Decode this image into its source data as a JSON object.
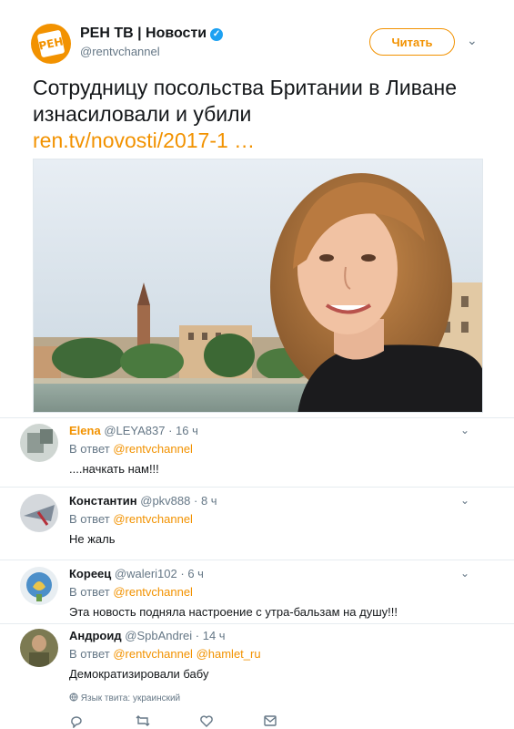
{
  "tweet": {
    "author_name": "РЕН ТВ | Новости",
    "author_handle": "@rentvchannel",
    "follow_label": "Читать",
    "text": "Сотрудницу посольства Британии в Ливане изнасиловали и убили",
    "link": "ren.tv/novosti/2017-1 …",
    "avatar_logo_text": "РЕН",
    "verified_symbol": "✓",
    "caret_symbol": "⌄"
  },
  "replies": [
    {
      "name": "Elena",
      "handle": "@LEYA837",
      "time": "· 16 ч",
      "reply_to_prefix": "В ответ ",
      "reply_to": "@rentvchannel",
      "reply_to_extra": "",
      "text": "....начкать нам!!!"
    },
    {
      "name": "Константин",
      "handle": "@pkv888",
      "time": "· 8 ч",
      "reply_to_prefix": "В ответ ",
      "reply_to": "@rentvchannel",
      "reply_to_extra": "",
      "text": "Не жаль"
    },
    {
      "name": "Кореец",
      "handle": "@waleri102",
      "time": "· 6 ч",
      "reply_to_prefix": "В ответ ",
      "reply_to": "@rentvchannel",
      "reply_to_extra": "",
      "text": "Эта новость подняла настроение с утра-бальзам на душу!!!"
    },
    {
      "name": "Андроид",
      "handle": "@SpbAndrei",
      "time": "· 14 ч",
      "reply_to_prefix": "В ответ ",
      "reply_to": "@rentvchannel",
      "reply_to_extra": " @hamlet_ru",
      "text": "Демократизировали бабу"
    }
  ],
  "footer": {
    "language_note": "Язык твита: украинский"
  },
  "colors": {
    "accent": "#f29200",
    "muted": "#657786",
    "text": "#14171a"
  },
  "icons": [
    "globe-icon",
    "reply-icon",
    "retweet-icon",
    "like-icon",
    "message-icon",
    "caret-down-icon"
  ]
}
